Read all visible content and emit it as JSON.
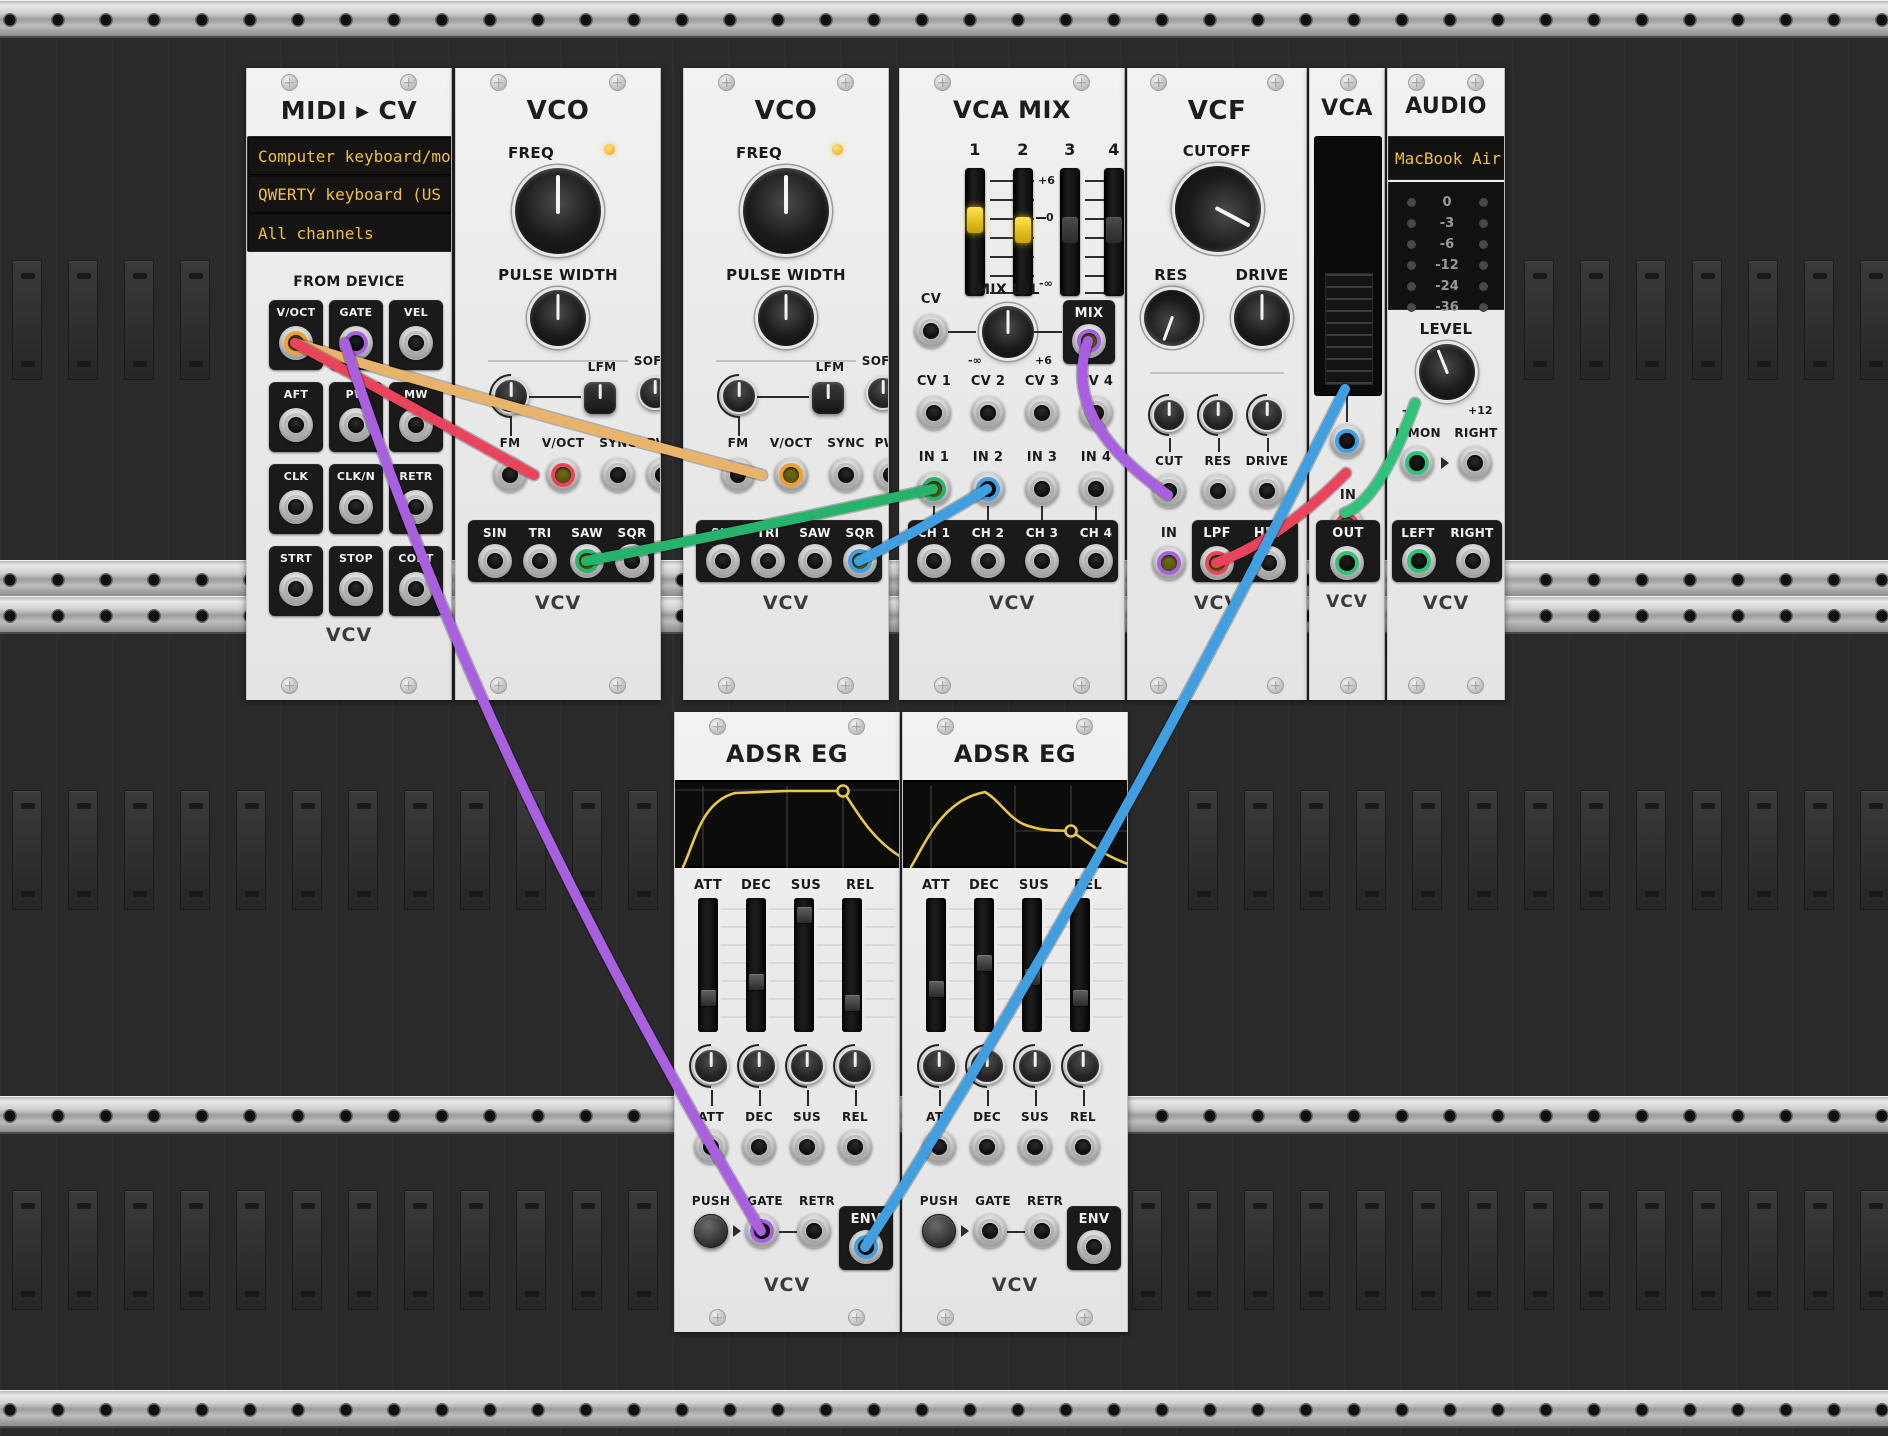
{
  "app": {
    "name": "VCV Rack",
    "rack_background": "#2e2e2e"
  },
  "modules": [
    {
      "id": "midi-cv",
      "title": "MIDI ▸ CV",
      "display_rows": [
        "Computer keyboard/mo",
        "QWERTY keyboard (US",
        "All channels"
      ],
      "section_label": "FROM DEVICE",
      "ports": [
        [
          "V/OCT",
          "GATE",
          "VEL"
        ],
        [
          "AFT",
          "PW",
          "MW"
        ],
        [
          "CLK",
          "CLK/N",
          "RETR"
        ],
        [
          "STRT",
          "STOP",
          "CONT"
        ]
      ],
      "brand": "VCV"
    },
    {
      "id": "vco-1",
      "title": "VCO",
      "knob_labels": {
        "freq": "FREQ",
        "pulse_width": "PULSE WIDTH"
      },
      "switch_labels": [
        "LFM",
        "SOFT"
      ],
      "input_labels": [
        "FM",
        "V/OCT",
        "SYNC",
        "PWM"
      ],
      "output_labels": [
        "SIN",
        "TRI",
        "SAW",
        "SQR"
      ],
      "brand": "VCV"
    },
    {
      "id": "vco-2",
      "title": "VCO",
      "knob_labels": {
        "freq": "FREQ",
        "pulse_width": "PULSE WIDTH"
      },
      "switch_labels": [
        "LFM",
        "SOFT"
      ],
      "input_labels": [
        "FM",
        "V/OCT",
        "SYNC",
        "PWM"
      ],
      "output_labels": [
        "SIN",
        "TRI",
        "SAW",
        "SQR"
      ],
      "brand": "VCV"
    },
    {
      "id": "vca-mix",
      "title": "VCA MIX",
      "channel_numbers": [
        "1",
        "2",
        "3",
        "4"
      ],
      "scale_labels": {
        "top": "+6",
        "mid": "0",
        "bottom": "-∞"
      },
      "slider_values": [
        0.62,
        0.52,
        0.52,
        0.52
      ],
      "cv_label": "CV",
      "mix_lvl_label": "MIX LVL",
      "mix_lvl_range": {
        "min": "-∞",
        "max": "+6"
      },
      "mix_out_label": "MIX",
      "cv_inputs": [
        "CV 1",
        "CV 2",
        "CV 3",
        "CV 4"
      ],
      "audio_inputs": [
        "IN 1",
        "IN 2",
        "IN 3",
        "IN 4"
      ],
      "channel_outputs": [
        "CH 1",
        "CH 2",
        "CH 3",
        "CH 4"
      ],
      "brand": "VCV"
    },
    {
      "id": "vcf",
      "title": "VCF",
      "knob_labels": {
        "cutoff": "CUTOFF",
        "res": "RES",
        "drive": "DRIVE"
      },
      "cv_labels": [
        "CUT",
        "RES",
        "DRIVE"
      ],
      "in_label": "IN",
      "output_labels": [
        "LPF",
        "HPF"
      ],
      "brand": "VCV"
    },
    {
      "id": "vca",
      "title": "VCA",
      "in_label": "IN",
      "out_label": "OUT",
      "brand": "VCV"
    },
    {
      "id": "audio",
      "title": "AUDIO",
      "device_name": "MacBook Air",
      "meter_labels": [
        "0",
        "-3",
        "-6",
        "-12",
        "-24",
        "-36"
      ],
      "level_label": "LEVEL",
      "level_range": {
        "min": "-∞",
        "max": "+12"
      },
      "output_labels": [
        "L/MON",
        "RIGHT"
      ],
      "input_labels": [
        "LEFT",
        "RIGHT"
      ],
      "brand": "VCV"
    },
    {
      "id": "adsr-1",
      "title": "ADSR EG",
      "slider_labels": [
        "ATT",
        "DEC",
        "SUS",
        "REL"
      ],
      "slider_values": [
        0.22,
        0.36,
        0.92,
        0.18
      ],
      "cv_labels": [
        "ATT",
        "DEC",
        "SUS",
        "REL"
      ],
      "push_label": "PUSH",
      "gate_label": "GATE",
      "retr_label": "RETR",
      "env_label": "ENV",
      "brand": "VCV",
      "envelope": {
        "attack": 0.18,
        "decay": 0.22,
        "sustain": 0.97,
        "release": 0.3
      }
    },
    {
      "id": "adsr-2",
      "title": "ADSR EG",
      "slider_labels": [
        "ATT",
        "DEC",
        "SUS",
        "REL"
      ],
      "slider_values": [
        0.3,
        0.52,
        0.4,
        0.22
      ],
      "cv_labels": [
        "ATT",
        "DEC",
        "SUS",
        "REL"
      ],
      "push_label": "PUSH",
      "gate_label": "GATE",
      "retr_label": "RETR",
      "env_label": "ENV",
      "brand": "VCV",
      "envelope": {
        "attack": 0.26,
        "decay": 0.4,
        "sustain": 0.42,
        "release": 0.3
      }
    }
  ],
  "cable_colors": {
    "orange": "#f0a030",
    "purple": "#a85fe0",
    "red": "#e8455c",
    "green": "#26b36b",
    "blue": "#3f9fe0",
    "light_green": "#2fc27a",
    "tan": "#e8b36a"
  },
  "cables": [
    {
      "from": "midi-cv.V/OCT",
      "to": "vco-2.V/OCT",
      "color": "#e8b36a"
    },
    {
      "from": "midi-cv.V/OCT",
      "to": "vco-1.V/OCT",
      "color": "#e8455c"
    },
    {
      "from": "midi-cv.GATE",
      "to": "adsr-1.GATE",
      "color": "#a85fe0"
    },
    {
      "from": "midi-cv.GATE",
      "to": "vca-mix.MIX",
      "color": "#a85fe0"
    },
    {
      "from": "vco-1.SAW",
      "to": "vca-mix.IN 1",
      "color": "#26b36b"
    },
    {
      "from": "vco-2.SQR",
      "to": "vca-mix.IN 2",
      "color": "#3f9fe0"
    },
    {
      "from": "vca-mix.MIX",
      "to": "vcf.IN",
      "color": "#a85fe0"
    },
    {
      "from": "vcf.LPF",
      "to": "vca.IN",
      "color": "#e8455c"
    },
    {
      "from": "adsr-1.ENV",
      "to": "vca.CV",
      "color": "#3f9fe0"
    },
    {
      "from": "vca.OUT",
      "to": "audio.L/MON",
      "color": "#2fc27a"
    }
  ]
}
